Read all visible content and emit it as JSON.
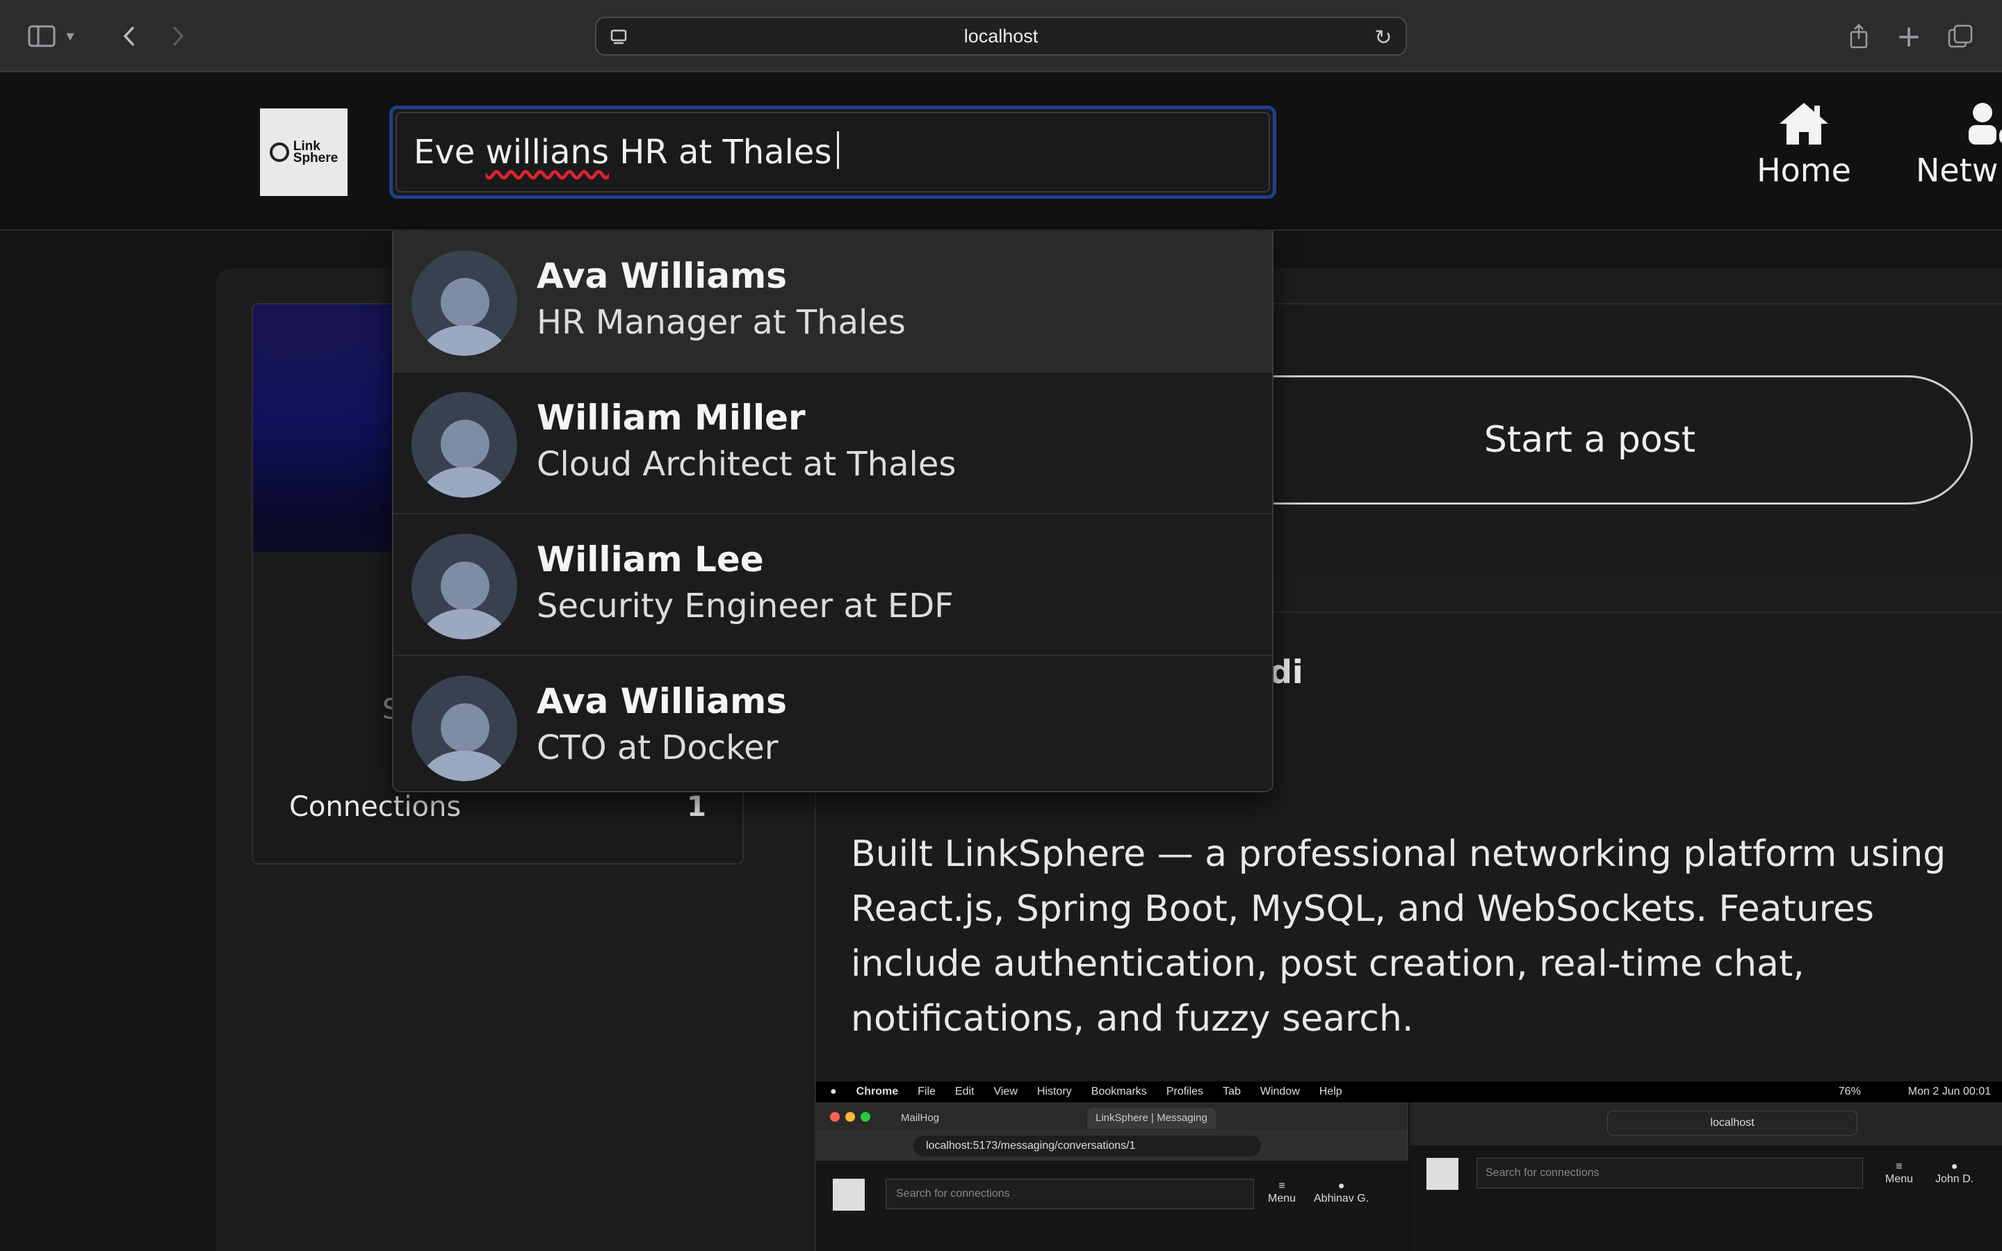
{
  "browser": {
    "url": "localhost"
  },
  "app": {
    "logo_text_1": "Link",
    "logo_text_2": "Sphere",
    "search": {
      "value_part1": "Eve ",
      "value_misspelled": "willians",
      "value_part2": " HR at Thales"
    },
    "nav": {
      "home": "Home",
      "network": "Netw"
    }
  },
  "suggestions": [
    {
      "name": "Ava Williams",
      "title": "HR Manager at Thales"
    },
    {
      "name": "William Miller",
      "title": "Cloud Architect at Thales"
    },
    {
      "name": "William Lee",
      "title": "Security Engineer at EDF"
    },
    {
      "name": "Ava Williams",
      "title": "CTO at Docker"
    }
  ],
  "profile_card": {
    "partial_text": "S",
    "connections_label": "Connections",
    "connections_count": "1"
  },
  "composer": {
    "start_post": "Start a post"
  },
  "feed": {
    "author_partial": "di",
    "post_text": "Built LinkSphere — a professional networking platform using React.js, Spring Boot, MySQL, and WebSockets. Features include authentication, post creation, real-time chat, notifications, and fuzzy search."
  },
  "embedded_screenshot": {
    "menu_bar": [
      "Chrome",
      "File",
      "Edit",
      "View",
      "History",
      "Bookmarks",
      "Profiles",
      "Tab",
      "Window",
      "Help"
    ],
    "menu_right": "Mon 2 Jun  00:01",
    "battery": "76%",
    "tab1": "MailHog",
    "tab2": "LinkSphere | Messaging",
    "url1": "localhost:5173/messaging/conversations/1",
    "search_placeholder": "Search for connections",
    "menu_label": "Menu",
    "user1": "Abhinav G.",
    "url2": "localhost",
    "user2": "John D."
  }
}
